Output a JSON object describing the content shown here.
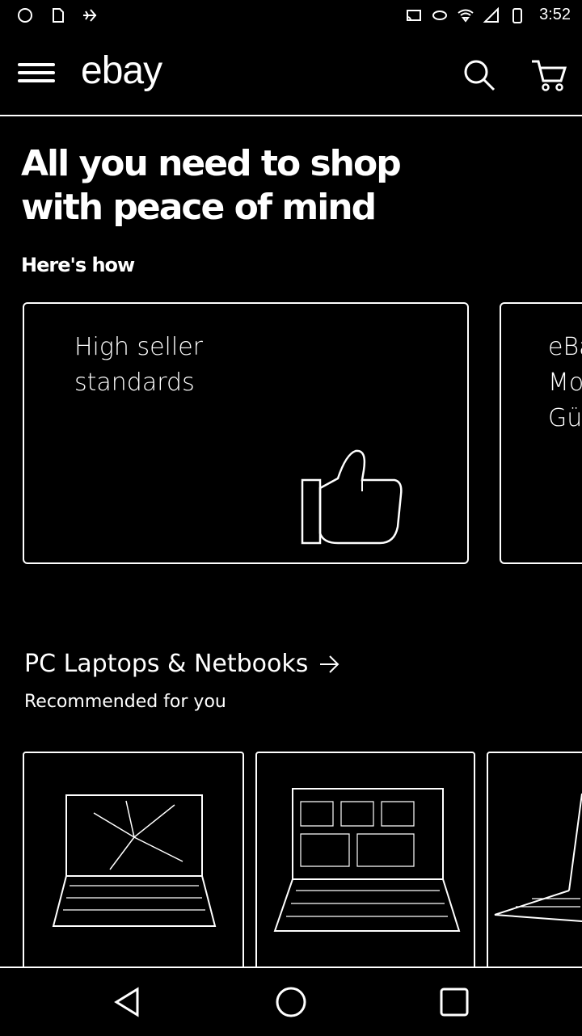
{
  "status_bar": {
    "time": "3:52",
    "left_icons": [
      "notification-circle-icon",
      "sim-icon",
      "airplane-icon"
    ],
    "right_icons": [
      "cast-icon",
      "data-icon",
      "wifi-icon",
      "signal-icon",
      "battery-icon"
    ]
  },
  "app_bar": {
    "logo_text": "ebay",
    "menu_icon": "menu-icon",
    "search_icon": "search-icon",
    "cart_icon": "cart-icon"
  },
  "hero": {
    "title": "All you need to shop with peace of mind",
    "link": "Here's how"
  },
  "cards": [
    {
      "text_line1": "High seller",
      "text_line2": "standards",
      "icon": "thumbs-up-icon"
    },
    {
      "text_line1": "eBa",
      "text_line2": "Mo",
      "text_line3": "Gü"
    }
  ],
  "section": {
    "title": "PC Laptops & Netbooks",
    "subtitle": "Recommended for you",
    "arrow_icon": "arrow-right-icon"
  },
  "products": [
    {
      "image": "laptop-icon"
    },
    {
      "image": "laptop-icon"
    },
    {
      "image": "laptop-icon"
    }
  ],
  "nav_bar": {
    "buttons": [
      "back-icon",
      "home-icon",
      "recents-icon"
    ]
  }
}
